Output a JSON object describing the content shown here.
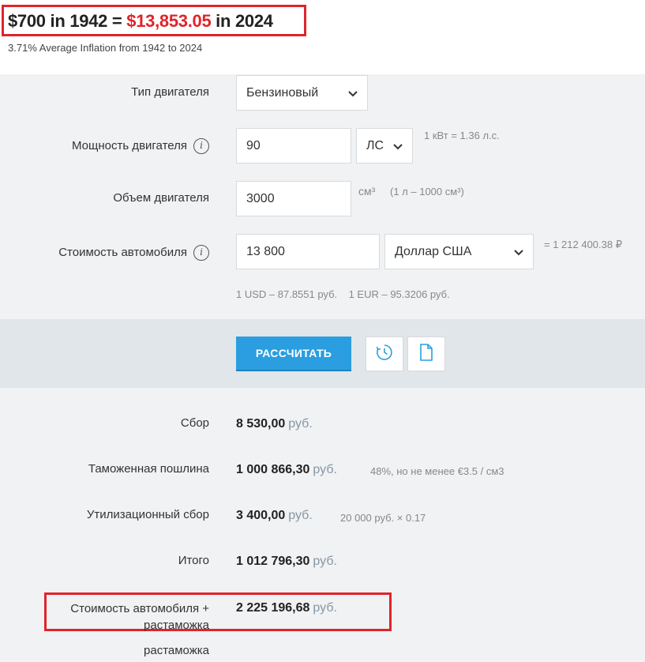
{
  "banner": {
    "amount_start": "$700",
    "in1": " in ",
    "year_start": "1942",
    "eq": " = ",
    "amount_end": "$13,853.05",
    "in2": " in ",
    "year_end": "2024",
    "subtitle": "3.71% Average Inflation from 1942 to 2024"
  },
  "form": {
    "engine_type": {
      "label": "Тип двигателя",
      "value": "Бензиновый"
    },
    "engine_power": {
      "label": "Мощность двигателя",
      "value": "90",
      "unit": "ЛС",
      "hint": "1 кВт = 1.36 л.с."
    },
    "engine_volume": {
      "label": "Объем двигателя",
      "value": "3000",
      "unit": "см³",
      "hint": "(1 л – 1000 см³)"
    },
    "car_price": {
      "label": "Стоимость автомобиля",
      "value": "13 800",
      "currency": "Доллар США",
      "converted": "= 1 212 400.38 ₽"
    },
    "rates": "1 USD – 87.8551 руб.    1 EUR – 95.3206 руб."
  },
  "actions": {
    "calculate_label": "РАССЧИТАТЬ"
  },
  "results": {
    "rows": [
      {
        "label": "Сбор",
        "value": "8 530,00",
        "currency": "руб.",
        "note": ""
      },
      {
        "label": "Таможенная пошлина",
        "value": "1 000 866,30",
        "currency": "руб.",
        "note": "48%, но не менее €3.5 / см3"
      },
      {
        "label": "Утилизационный сбор",
        "value": "3 400,00",
        "currency": "руб.",
        "note": "20 000 руб. × 0.17"
      },
      {
        "label": "Итого",
        "value": "1 012 796,30",
        "currency": "руб.",
        "note": ""
      }
    ],
    "total": {
      "label_line1": "Стоимость автомобиля +",
      "label_line2": "растаможка",
      "value": "2 225 196,68",
      "currency": "руб."
    },
    "trailing_label": "растаможка"
  },
  "colors": {
    "highlight": "#e0242b",
    "accent": "#2a9ee0"
  }
}
